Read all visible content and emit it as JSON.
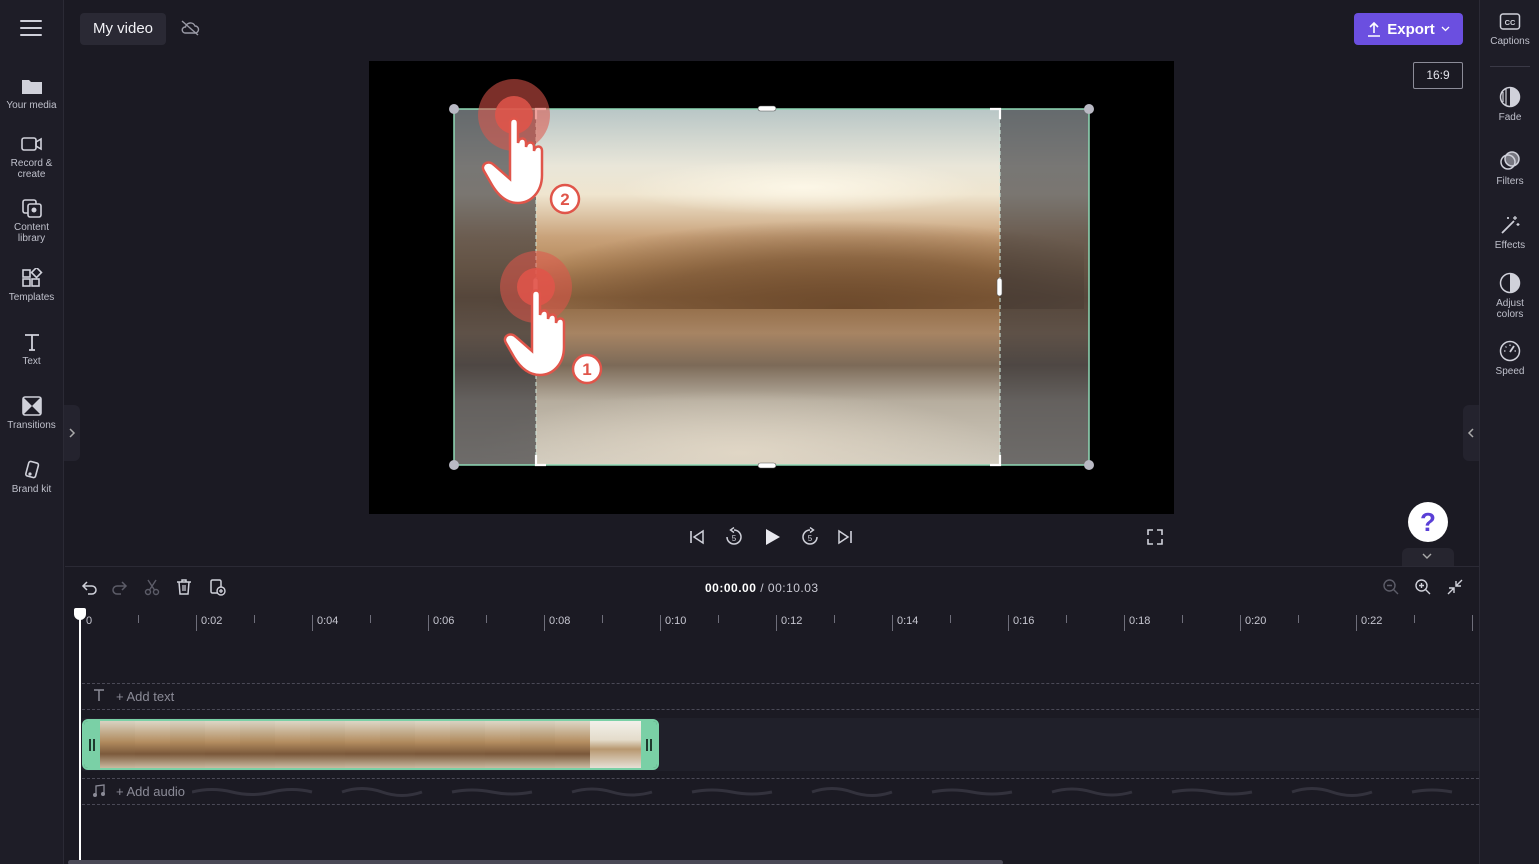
{
  "app": {
    "project_name": "My video",
    "export_label": "Export",
    "aspect_ratio": "16:9",
    "help_label": "?"
  },
  "left_sidebar": {
    "items": [
      {
        "label": "Your media",
        "icon": "folder-icon"
      },
      {
        "label": "Record &",
        "label2": "create",
        "icon": "camera-icon"
      },
      {
        "label": "Content",
        "label2": "library",
        "icon": "content-library-icon"
      },
      {
        "label": "Templates",
        "icon": "templates-icon"
      },
      {
        "label": "Text",
        "icon": "text-icon"
      },
      {
        "label": "Transitions",
        "icon": "transitions-icon"
      },
      {
        "label": "Brand kit",
        "icon": "brand-kit-icon"
      }
    ]
  },
  "right_sidebar": {
    "items": [
      {
        "label": "Captions",
        "icon": "captions-icon"
      },
      {
        "label": "Fade",
        "icon": "fade-icon"
      },
      {
        "label": "Filters",
        "icon": "filters-icon"
      },
      {
        "label": "Effects",
        "icon": "effects-icon"
      },
      {
        "label": "Adjust",
        "label2": "colors",
        "icon": "adjust-colors-icon"
      },
      {
        "label": "Speed",
        "icon": "speed-icon"
      }
    ]
  },
  "preview": {
    "step_badges": [
      "2",
      "1"
    ]
  },
  "timeline": {
    "current_time": "00:00.00",
    "separator": " / ",
    "total_time": "00:10.03",
    "ruler_labels": [
      "0",
      "0:02",
      "0:04",
      "0:06",
      "0:08",
      "0:10",
      "0:12",
      "0:14",
      "0:16",
      "0:18",
      "0:20",
      "0:22"
    ],
    "add_text_label": "+ Add text",
    "add_audio_label": "+ Add audio"
  },
  "colors": {
    "accent": "#6b4fe0",
    "clip_border": "#7ad0a6",
    "crop_outline": "#8fd9b6",
    "click_indicator": "#e0554a",
    "background": "#1b1a23"
  }
}
